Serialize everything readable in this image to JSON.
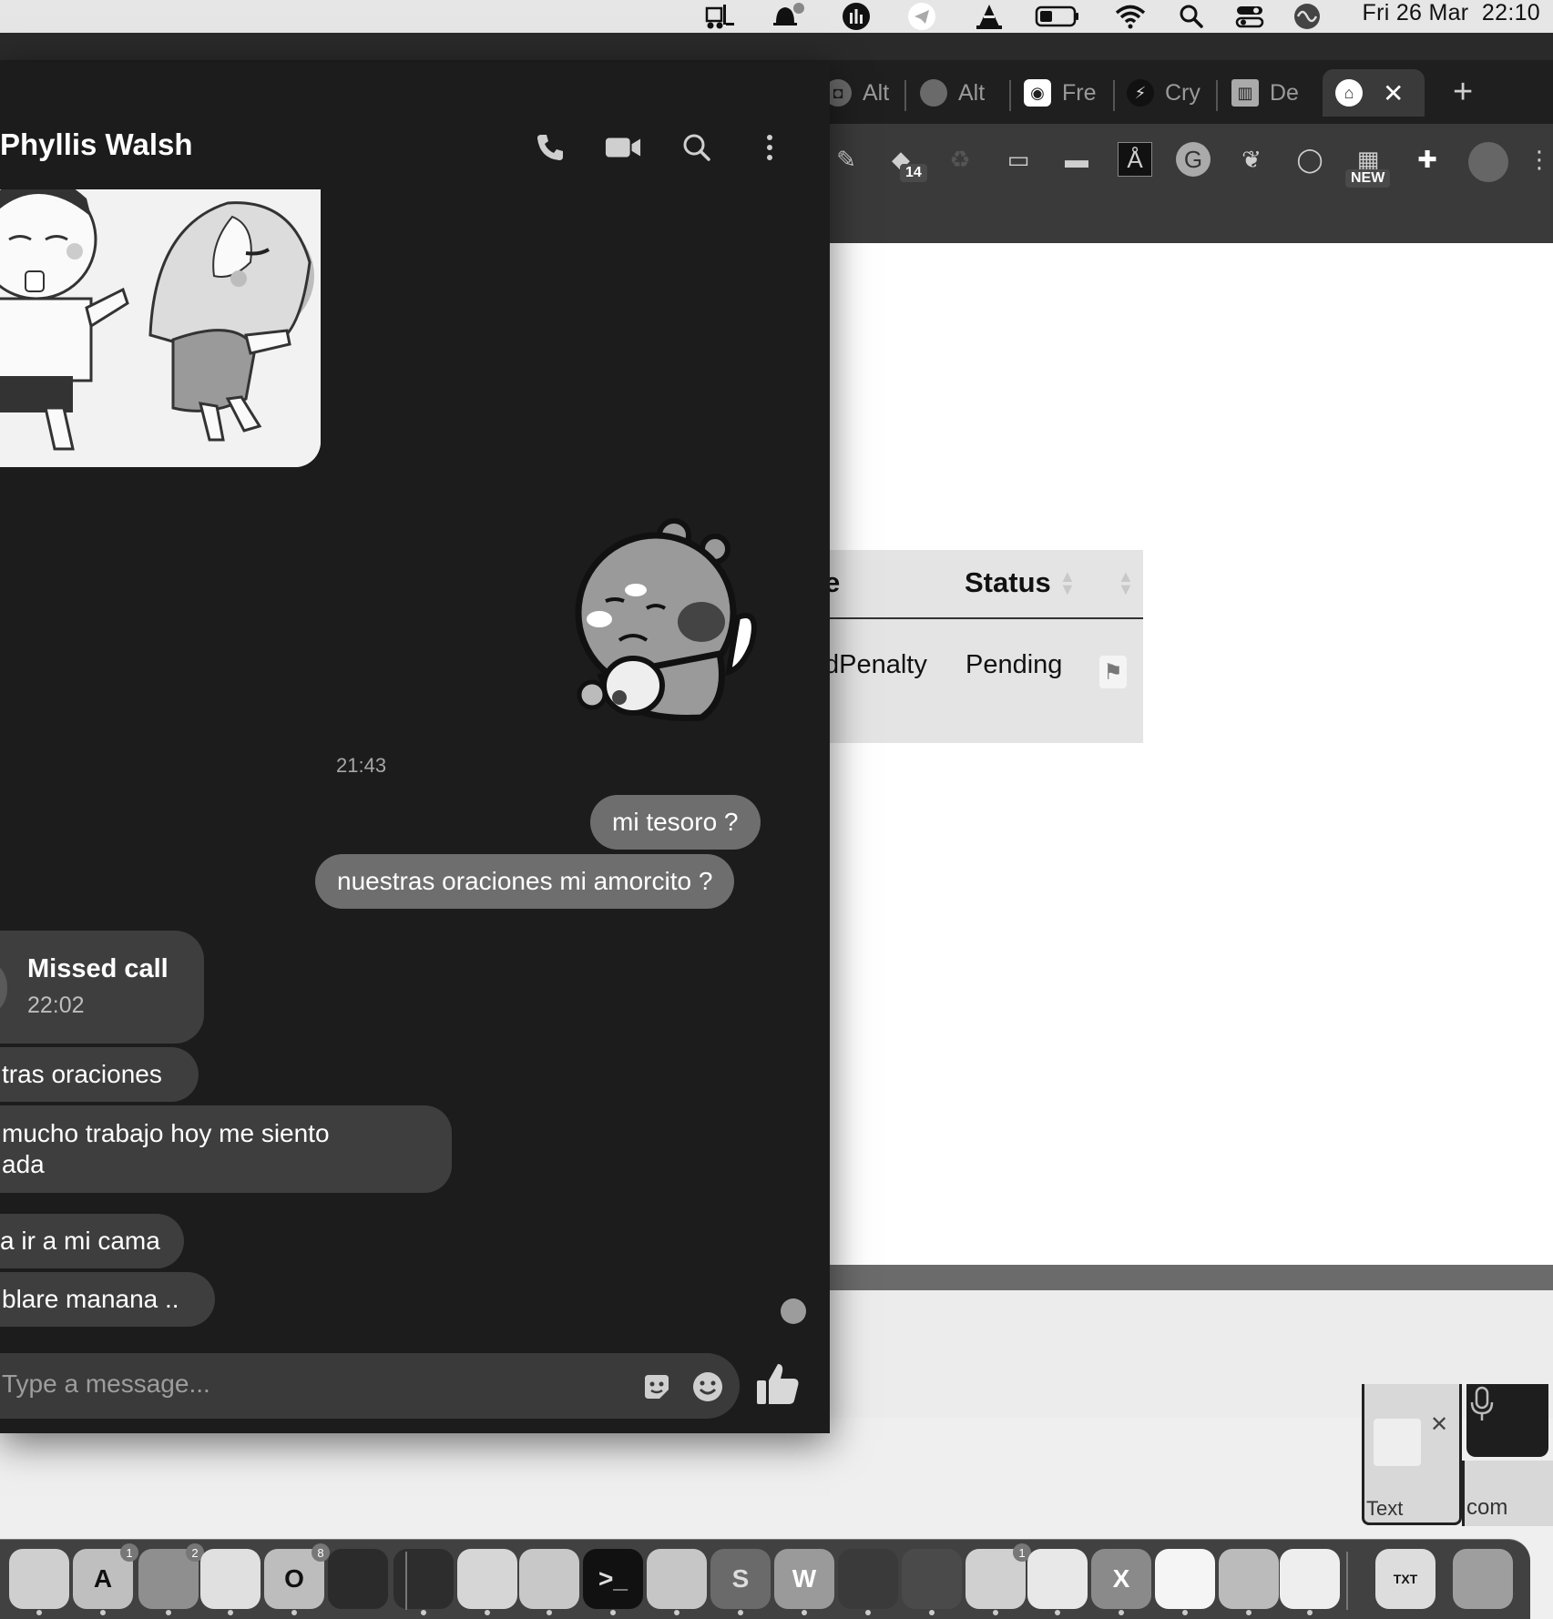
{
  "menubar": {
    "clock": "Fri 26 Mar  22:10",
    "icons": [
      "forklift-icon",
      "notification-bell-icon",
      "istat-menus-icon",
      "telegram-icon",
      "vlc-cone-icon",
      "battery-icon",
      "wifi-icon",
      "spotlight-search-icon",
      "control-center-icon",
      "siri-icon"
    ]
  },
  "browser": {
    "tabs": [
      {
        "label": "Alt",
        "icon": "screenshot-icon"
      },
      {
        "label": "Alt",
        "icon": "circle-app-icon"
      },
      {
        "label": "Fre",
        "icon": "camera-icon"
      },
      {
        "label": "Cry",
        "icon": "bolt-icon"
      },
      {
        "label": "De",
        "icon": "columns-icon"
      },
      {
        "label": "",
        "icon": "museum-icon",
        "active": true
      }
    ],
    "close_glyph": "✕",
    "new_tab_glyph": "+",
    "extensions": [
      {
        "name": "pen-extension-icon"
      },
      {
        "name": "layers-extension-icon",
        "badge": "14"
      },
      {
        "name": "recycle-extension-icon"
      },
      {
        "name": "printer-extension-icon"
      },
      {
        "name": "analytics-extension-icon"
      },
      {
        "name": "font-a-extension-icon",
        "glyph": "Å"
      },
      {
        "name": "grammarly-extension-icon",
        "glyph": "G"
      },
      {
        "name": "evernote-extension-icon"
      },
      {
        "name": "record-extension-icon"
      },
      {
        "name": "new-extension-icon",
        "badge": "NEW"
      },
      {
        "name": "puzzle-extensions-icon"
      },
      {
        "name": "profile-avatar-icon"
      }
    ],
    "table": {
      "col_cut_header": "e",
      "col_status_header": "Status",
      "row": {
        "type_cut": "dPenalty",
        "status": "Pending"
      }
    },
    "text_widget_label": "Text",
    "com_widget_label": "com"
  },
  "chat": {
    "contact_name": "Phyllis Walsh",
    "time_divider": "21:43",
    "outgoing": [
      "mi tesoro ?",
      "nuestras oraciones mi amorcito ?"
    ],
    "missed_call": {
      "title": "Missed call",
      "time": "22:02"
    },
    "incoming": [
      "tras oraciones",
      "mucho trabajo hoy me siento",
      "ada",
      "a ir a mi cama",
      "blare manana .."
    ],
    "composer_placeholder": "Type a message..."
  },
  "dock": {
    "apps": [
      {
        "name": "podcasts",
        "glyph": ""
      },
      {
        "name": "app-store",
        "glyph": "A",
        "badge": "1"
      },
      {
        "name": "system-preferences",
        "glyph": "",
        "badge": "2"
      },
      {
        "name": "chrome",
        "glyph": ""
      },
      {
        "name": "outlook",
        "glyph": "O",
        "badge": "8"
      },
      {
        "name": "opera",
        "glyph": ""
      },
      {
        "name": "activity-monitor",
        "glyph": ""
      },
      {
        "name": "whatsapp",
        "glyph": ""
      },
      {
        "name": "forklift",
        "glyph": ""
      },
      {
        "name": "terminal",
        "glyph": ">_"
      },
      {
        "name": "telegram",
        "glyph": ""
      },
      {
        "name": "sublime-text",
        "glyph": "S"
      },
      {
        "name": "word",
        "glyph": "W"
      },
      {
        "name": "vlc",
        "glyph": ""
      },
      {
        "name": "spider-app",
        "glyph": ""
      },
      {
        "name": "messenger",
        "glyph": "",
        "badge": "1"
      },
      {
        "name": "screenshot-app",
        "glyph": ""
      },
      {
        "name": "excel",
        "glyph": "X"
      },
      {
        "name": "blank-document",
        "glyph": ""
      },
      {
        "name": "disk-utility",
        "glyph": ""
      },
      {
        "name": "textedit",
        "glyph": ""
      },
      {
        "name": "txt-file",
        "glyph": "TXT"
      },
      {
        "name": "trash",
        "glyph": ""
      }
    ]
  }
}
